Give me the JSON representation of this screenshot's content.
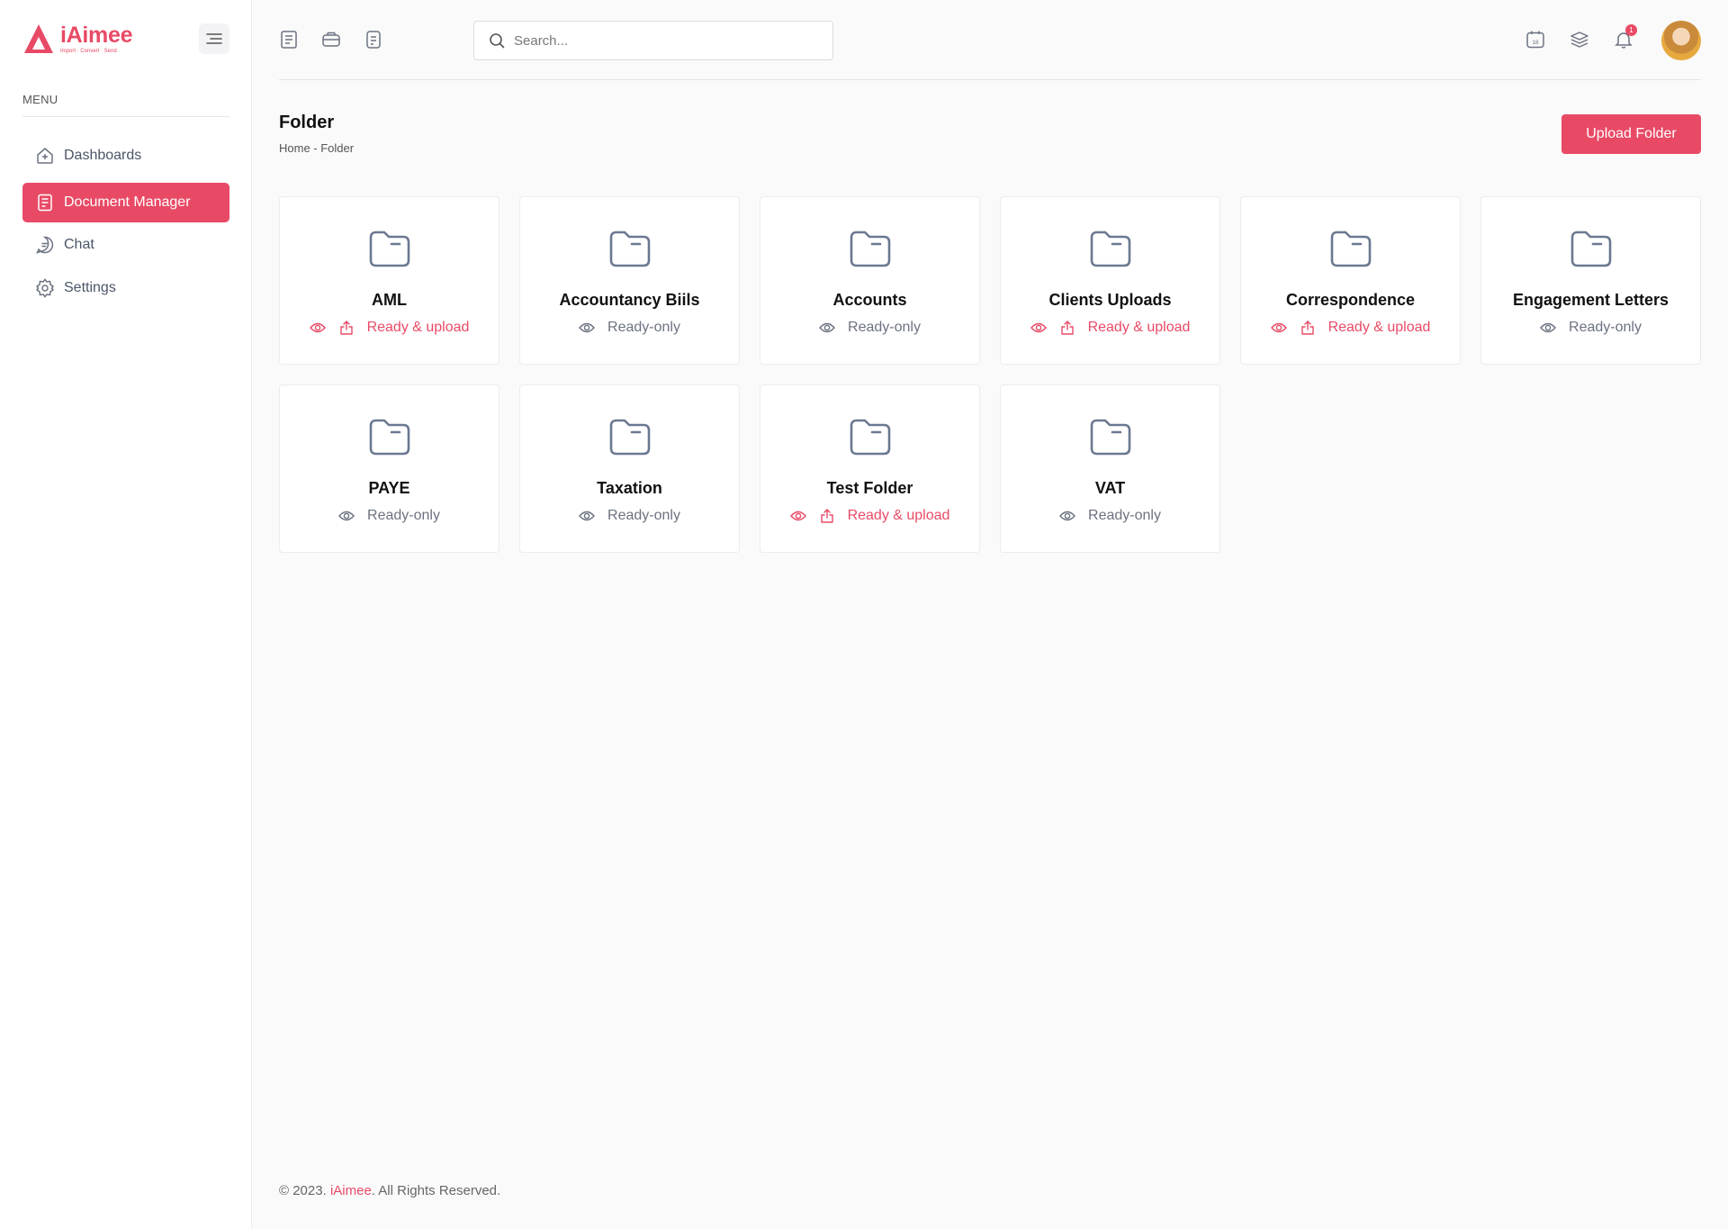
{
  "app": {
    "name": "iAimee",
    "tagline": "Import · Convert · Send",
    "accent": "#e84a66"
  },
  "sidebar": {
    "menu_label": "MENU",
    "items": [
      {
        "label": "Dashboards",
        "icon": "home-icon",
        "active": false
      },
      {
        "label": "Document Manager",
        "icon": "document-icon",
        "active": true
      },
      {
        "label": "Chat",
        "icon": "chat-icon",
        "active": false
      },
      {
        "label": "Settings",
        "icon": "gear-icon",
        "active": false
      }
    ]
  },
  "topbar": {
    "search_placeholder": "Search...",
    "calendar_day": "18",
    "notification_count": "1"
  },
  "header": {
    "title": "Folder",
    "breadcrumb": "Home - Folder",
    "upload_button": "Upload Folder"
  },
  "folders": [
    {
      "name": "AML",
      "permission": "Ready & upload",
      "upload": true
    },
    {
      "name": "Accountancy Biils",
      "permission": "Ready-only",
      "upload": false
    },
    {
      "name": "Accounts",
      "permission": "Ready-only",
      "upload": false
    },
    {
      "name": "Clients Uploads",
      "permission": "Ready & upload",
      "upload": true
    },
    {
      "name": "Correspondence",
      "permission": "Ready & upload",
      "upload": true
    },
    {
      "name": "Engagement Letters",
      "permission": "Ready-only",
      "upload": false
    },
    {
      "name": "PAYE",
      "permission": "Ready-only",
      "upload": false
    },
    {
      "name": "Taxation",
      "permission": "Ready-only",
      "upload": false
    },
    {
      "name": "Test Folder",
      "permission": "Ready & upload",
      "upload": true
    },
    {
      "name": "VAT",
      "permission": "Ready-only",
      "upload": false
    }
  ],
  "footer": {
    "prefix": "© 2023. ",
    "brand": "iAimee",
    "suffix": ". All Rights Reserved."
  }
}
